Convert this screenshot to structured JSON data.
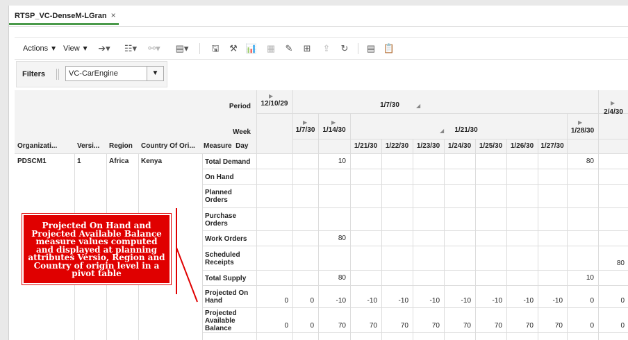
{
  "tab": {
    "title": "RTSP_VC-DenseM-LGran",
    "close": "×"
  },
  "toolbar": {
    "actions": "Actions",
    "view": "View",
    "caret": "▼"
  },
  "filters": {
    "label": "Filters",
    "value": "VC-CarEngine",
    "dropdown": "▼"
  },
  "header": {
    "period": "Period",
    "week": "Week",
    "measure_day": "Measure  Day",
    "dims": [
      "Organizati...",
      "Versi...",
      "Region",
      "Country Of Ori..."
    ],
    "p1": "12/10/29",
    "p2": "1/7/30",
    "p3": "2/4/30",
    "w1": "1/7/30",
    "w2": "1/14/30",
    "w3": "1/21/30",
    "w4": "1/28/30",
    "days": [
      "1/21/30",
      "1/22/30",
      "1/23/30",
      "1/24/30",
      "1/25/30",
      "1/26/30",
      "1/27/30"
    ]
  },
  "row_attrs": {
    "org": "PDSCM1",
    "version": "1",
    "region": "Africa",
    "country": "Kenya"
  },
  "measures": [
    {
      "label1": "Total Demand",
      "label2": "",
      "values": [
        "",
        "",
        "10",
        "",
        "",
        "",
        "",
        "",
        "",
        "",
        "80",
        ""
      ]
    },
    {
      "label1": "On Hand",
      "label2": "",
      "values": [
        "",
        "",
        "",
        "",
        "",
        "",
        "",
        "",
        "",
        "",
        "",
        ""
      ]
    },
    {
      "label1": "Planned",
      "label2": "Orders",
      "values": [
        "",
        "",
        "",
        "",
        "",
        "",
        "",
        "",
        "",
        "",
        "",
        ""
      ]
    },
    {
      "label1": "Purchase",
      "label2": "Orders",
      "values": [
        "",
        "",
        "",
        "",
        "",
        "",
        "",
        "",
        "",
        "",
        "",
        ""
      ]
    },
    {
      "label1": "Work Orders",
      "label2": "",
      "values": [
        "",
        "",
        "80",
        "",
        "",
        "",
        "",
        "",
        "",
        "",
        "",
        ""
      ]
    },
    {
      "label1": "Scheduled",
      "label2": "Receipts",
      "values": [
        "",
        "",
        "",
        "",
        "",
        "",
        "",
        "",
        "",
        "",
        "",
        "80"
      ]
    },
    {
      "label1": "Total Supply",
      "label2": "",
      "values": [
        "",
        "",
        "80",
        "",
        "",
        "",
        "",
        "",
        "",
        "",
        "10",
        ""
      ]
    },
    {
      "label1": "Projected On",
      "label2": "Hand",
      "values": [
        "0",
        "0",
        "-10",
        "-10",
        "-10",
        "-10",
        "-10",
        "-10",
        "-10",
        "-10",
        "0",
        "0"
      ]
    },
    {
      "label1": "Projected",
      "label2": "Available",
      "label3": "Balance",
      "values": [
        "0",
        "0",
        "70",
        "70",
        "70",
        "70",
        "70",
        "70",
        "70",
        "70",
        "0",
        "0"
      ]
    }
  ],
  "callout": {
    "text": "Projected On Hand and Projected Available Balance measure values computed and displayed at planning attributes Versio, Region and Country of origin level in a pivot table"
  },
  "colors": {
    "accent": "#4a9a4a",
    "callout": "#e00000"
  }
}
